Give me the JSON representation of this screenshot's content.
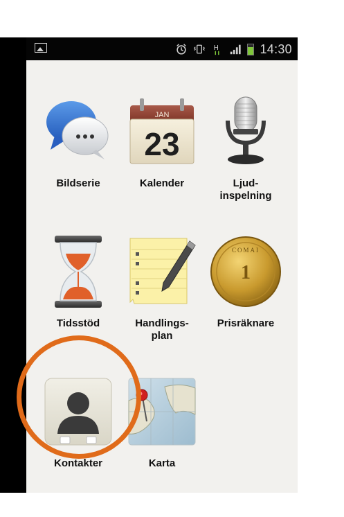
{
  "statusbar": {
    "time": "14:30",
    "network": "H",
    "icons": [
      "image-icon",
      "alarm-icon",
      "vibrate-icon",
      "network-type-icon",
      "signal-icon",
      "battery-icon"
    ]
  },
  "apps": [
    {
      "label": "Bildserie",
      "icon": "chat-bubbles-icon"
    },
    {
      "label": "Kalender",
      "icon": "calendar-icon",
      "calendar_month": "JAN",
      "calendar_day": "23"
    },
    {
      "label": "Ljud-\ninspelning",
      "icon": "microphone-icon"
    },
    {
      "label": "Tidsstöd",
      "icon": "hourglass-icon"
    },
    {
      "label": "Handlings-\nplan",
      "icon": "notepad-icon"
    },
    {
      "label": "Prisräknare",
      "icon": "coin-icon",
      "coin_text": "COMAI",
      "coin_value": "1"
    },
    {
      "label": "Kontakter",
      "icon": "contact-card-icon"
    },
    {
      "label": "Karta",
      "icon": "map-icon"
    }
  ],
  "colors": {
    "highlight": "#e06b1a",
    "background": "#f2f1ee",
    "statusbar": "#050505"
  }
}
